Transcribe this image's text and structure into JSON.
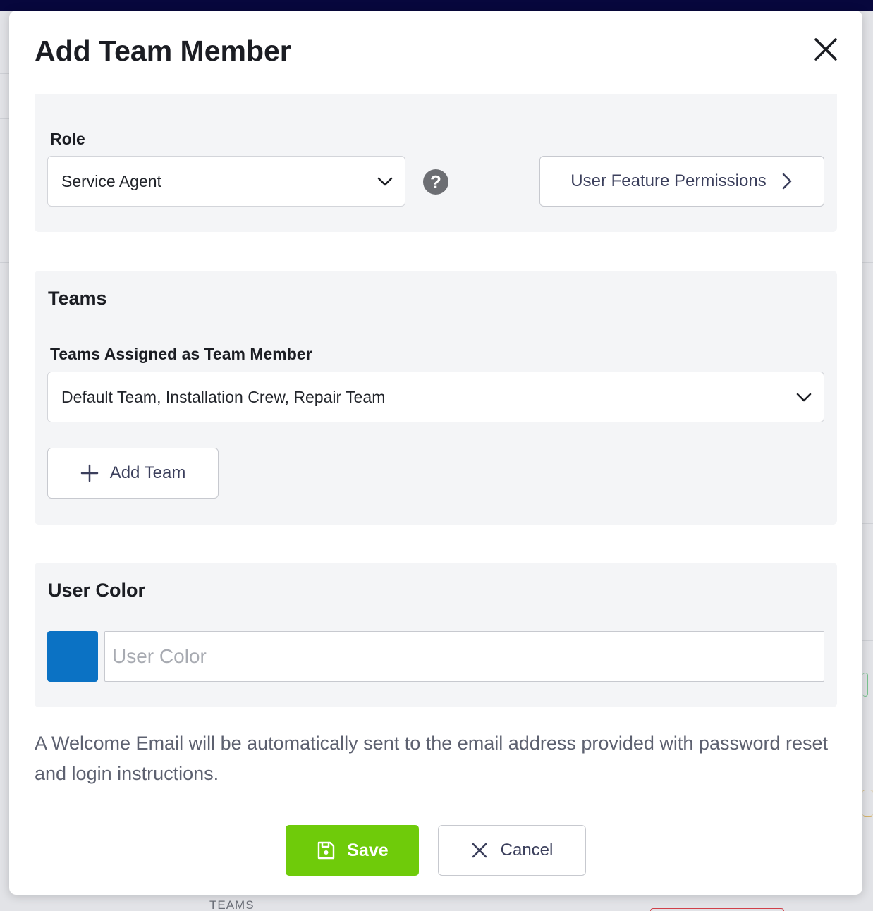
{
  "background": {
    "teams_label": "TEAMS"
  },
  "modal": {
    "title": "Add Team Member"
  },
  "role": {
    "label": "Role",
    "selected": "Service Agent",
    "permissions_button": "User Feature Permissions"
  },
  "teams": {
    "title": "Teams",
    "assigned_label": "Teams Assigned as Team Member",
    "selected": "Default Team, Installation Crew, Repair Team",
    "add_button": "Add Team"
  },
  "user_color": {
    "title": "User Color",
    "placeholder": "User Color",
    "value": "",
    "swatch_color": "#0b72c4"
  },
  "info": {
    "text": "A Welcome Email will be automatically sent to the email address provided with password reset and login instructions."
  },
  "actions": {
    "save_label": "Save",
    "cancel_label": "Cancel",
    "save_color": "#6fcb0a"
  }
}
